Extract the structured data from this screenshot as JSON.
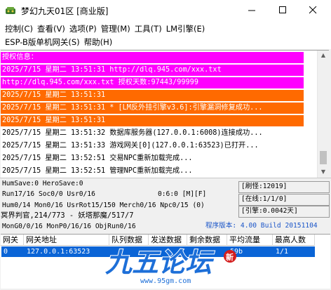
{
  "window": {
    "title": "梦幻九天01区 [商业版]",
    "minimize_glyph": "—",
    "maximize_glyph": "☐",
    "close_glyph": "✕"
  },
  "menu": {
    "row1": [
      "控制(C)",
      "查看(V)",
      "选项(P)",
      "管理(M)",
      "工具(T)",
      "LM引擎(E)"
    ],
    "row2": [
      "ESP-B版单机网关(S)",
      "帮助(H)"
    ]
  },
  "log": [
    {
      "text": "授权信息：",
      "highlight": "magenta"
    },
    {
      "text": "2025/7/15 星期二 13:51:31 http://dlq.945.com/xxx.txt",
      "highlight": "magenta"
    },
    {
      "text": "http://dlq.945.com/xxx.txt 授权天数:97443/99999",
      "highlight": "magenta"
    },
    {
      "text": "2025/7/15 星期二 13:51:31",
      "highlight": "orange"
    },
    {
      "text": "2025/7/15 星期二 13:51:31 * [LM反外挂引擎v3.6]:引擎漏洞修复成功...",
      "highlight": "orange"
    },
    {
      "text": "2025/7/15 星期二 13:51:31",
      "highlight": "orange"
    },
    {
      "text": "2025/7/15 星期二 13:51:32 数据库服务器(127.0.0.1:6008)连接成功...",
      "highlight": "none"
    },
    {
      "text": "2025/7/15 星期二 13:51:33 游戏网关[0](127.0.0.1:63523)已打开...",
      "highlight": "none"
    },
    {
      "text": "2025/7/15 星期二 13:52:51 交易NPC重新加载完成...",
      "highlight": "none"
    },
    {
      "text": "2025/7/15 星期二 13:52:51 管理NPC重新加载完成...",
      "highlight": "none"
    }
  ],
  "stats": {
    "save": "HumSave:0 HeroSave:0",
    "run": "Run17/16 Soc0/0 Usr0/16",
    "time": "0:6:0 [M][F]",
    "hum": "Hum0/14 Mon0/16 UsrRot15/150 Merch0/16 Npc0/15 (0)",
    "map": "冥界判官,214/773 - 妖塔那魔/517/7",
    "mon": "MonG0/0/16 MonP0/16/16 ObjRun0/16",
    "refresh": "[刷怪:12019]",
    "online": "[在线:1/1/0]",
    "engine": "[引擎:0.0042天]",
    "version": "程序版本: 4.00 Build 20151104"
  },
  "table": {
    "headers": [
      "网关",
      "网关地址",
      "队列数据",
      "发送数据",
      "剩余数据",
      "平均流量",
      "最高人数"
    ],
    "rows": [
      [
        "0",
        "127.0.0.1:63523",
        "",
        "",
        "",
        "59b",
        "1/1"
      ]
    ]
  },
  "watermark": {
    "logo": "九五论坛",
    "url": "www.95gm.com"
  },
  "colors": {
    "magenta": "#ff00ff",
    "orange": "#ff6a00",
    "selection": "#0a64d6",
    "version_text": "#1a55c8"
  }
}
